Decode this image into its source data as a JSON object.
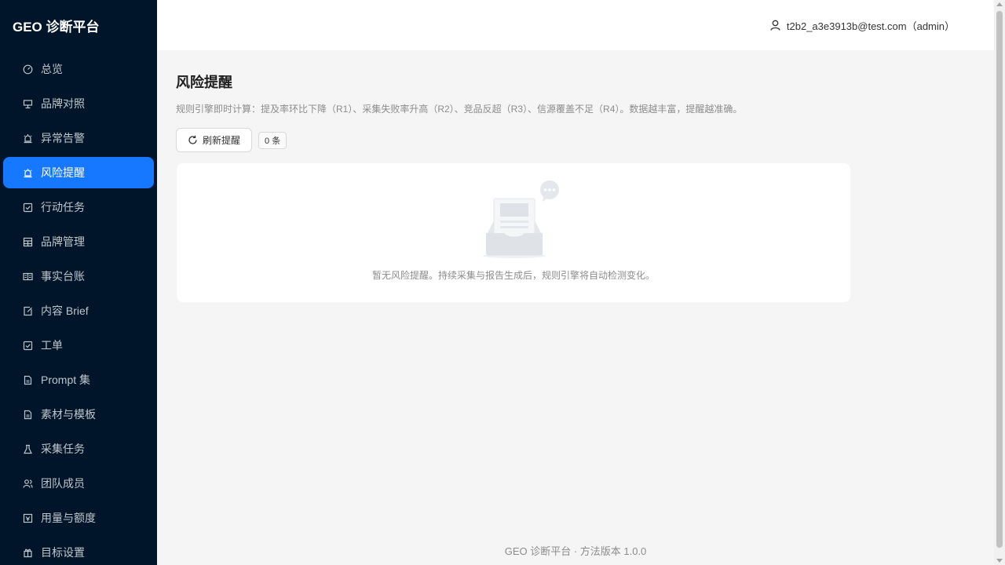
{
  "app": {
    "title": "GEO 诊断平台"
  },
  "sidebar": {
    "items": [
      {
        "label": "总览",
        "icon": "dashboard-icon",
        "active": false
      },
      {
        "label": "品牌对照",
        "icon": "compare-icon",
        "active": false
      },
      {
        "label": "异常告警",
        "icon": "alert-icon",
        "active": false
      },
      {
        "label": "风险提醒",
        "icon": "alert-icon",
        "active": true
      },
      {
        "label": "行动任务",
        "icon": "checkbox-icon",
        "active": false
      },
      {
        "label": "品牌管理",
        "icon": "table-icon",
        "active": false
      },
      {
        "label": "事实台账",
        "icon": "ledger-icon",
        "active": false
      },
      {
        "label": "内容 Brief",
        "icon": "edit-doc-icon",
        "active": false
      },
      {
        "label": "工单",
        "icon": "checkbox-icon",
        "active": false
      },
      {
        "label": "Prompt 集",
        "icon": "file-icon",
        "active": false
      },
      {
        "label": "素材与模板",
        "icon": "file-icon",
        "active": false
      },
      {
        "label": "采集任务",
        "icon": "flask-icon",
        "active": false
      },
      {
        "label": "团队成员",
        "icon": "team-icon",
        "active": false
      },
      {
        "label": "用量与额度",
        "icon": "quota-icon",
        "active": false
      },
      {
        "label": "目标设置",
        "icon": "gift-icon",
        "active": false
      }
    ]
  },
  "header": {
    "user": "t2b2_a3e3913b@test.com（admin）"
  },
  "main": {
    "title": "风险提醒",
    "description": "规则引擎即时计算：提及率环比下降（R1）、采集失败率升高（R2）、竞品反超（R3）、信源覆盖不足（R4）。数据越丰富，提醒越准确。",
    "refresh_label": "刷新提醒",
    "count_label": "0 条",
    "empty_text": "暂无风险提醒。持续采集与报告生成后，规则引擎将自动检测变化。"
  },
  "footer": {
    "text": "GEO 诊断平台 · 方法版本 1.0.0"
  },
  "colors": {
    "sidebar_bg": "#001529",
    "accent": "#1677ff",
    "page_bg": "#f5f5f5"
  }
}
